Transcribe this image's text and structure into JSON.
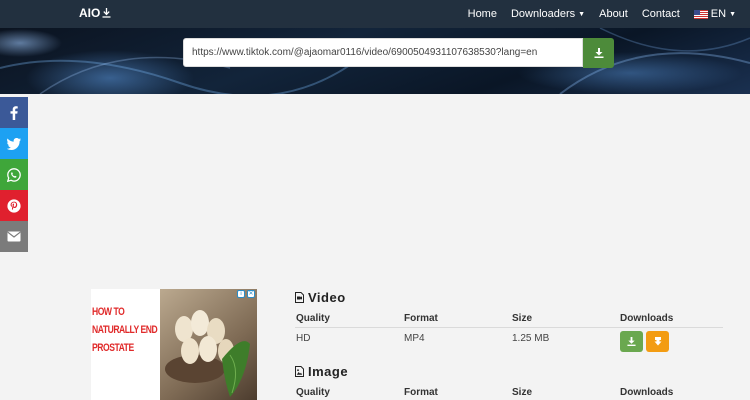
{
  "navbar": {
    "brand": "AIO",
    "items": [
      "Home",
      "Downloaders",
      "About",
      "Contact"
    ],
    "language": "EN"
  },
  "search": {
    "url_value": "https://www.tiktok.com/@ajaomar0116/video/6900504931107638530?lang=en"
  },
  "share": [
    "facebook-icon",
    "twitter-icon",
    "whatsapp-icon",
    "pinterest-icon",
    "email-icon"
  ],
  "ad": {
    "text_lines": [
      "HOW TO",
      "NATURALLY END",
      "PROSTATE"
    ]
  },
  "video": {
    "title": "Video",
    "headers": [
      "Quality",
      "Format",
      "Size",
      "Downloads"
    ],
    "rows": [
      {
        "quality": "HD",
        "format": "MP4",
        "size": "1.25 MB"
      }
    ]
  },
  "image": {
    "title": "Image",
    "headers": [
      "Quality",
      "Format",
      "Size",
      "Downloads"
    ]
  },
  "colors": {
    "navbar": "#22303f",
    "download_green": "#6aa84f",
    "download_orange": "#f39c12",
    "facebook": "#3b5998",
    "twitter": "#1da1f2",
    "whatsapp": "#3fa63a",
    "pinterest": "#e0202e",
    "email": "#7b7b7b"
  }
}
